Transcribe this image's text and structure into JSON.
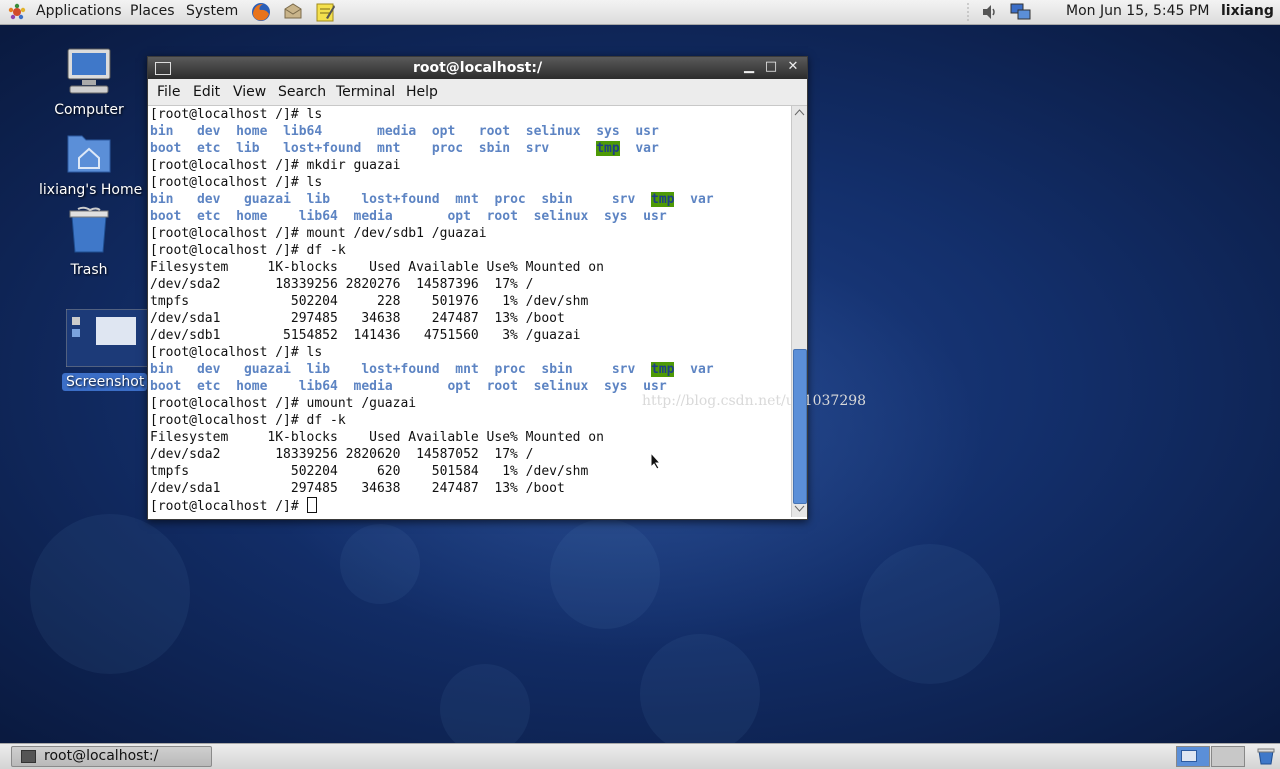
{
  "top_panel": {
    "menus": [
      "Applications",
      "Places",
      "System"
    ],
    "clock": "Mon Jun 15,  5:45 PM",
    "user": "lixiang"
  },
  "desktop": {
    "icons": [
      {
        "label": "Computer"
      },
      {
        "label": "lixiang's Home"
      },
      {
        "label": "Trash"
      },
      {
        "label": "Screenshot"
      }
    ]
  },
  "window": {
    "title": "root@localhost:/",
    "menu": [
      "File",
      "Edit",
      "View",
      "Search",
      "Terminal",
      "Help"
    ],
    "watermark": "http://blog.csdn.net/u01037298"
  },
  "terminal": {
    "lines": [
      {
        "t": "text",
        "v": "[root@localhost /]# ls"
      },
      {
        "t": "dirs",
        "v": [
          "bin   ",
          "dev  ",
          "home  ",
          "lib64       ",
          "media  ",
          "opt   ",
          "root  ",
          "selinux  ",
          "sys  ",
          "usr"
        ]
      },
      {
        "t": "dirs",
        "v": [
          "boot  ",
          "etc  ",
          "lib   ",
          "lost+found  ",
          "mnt    ",
          "proc  ",
          "sbin  ",
          "srv      ",
          "tmp  ",
          "var"
        ]
      },
      {
        "t": "text",
        "v": "[root@localhost /]# mkdir guazai"
      },
      {
        "t": "text",
        "v": "[root@localhost /]# ls"
      },
      {
        "t": "dirs",
        "v": [
          "bin   ",
          "dev   ",
          "guazai  ",
          "lib    ",
          "lost+found  ",
          "mnt  ",
          "proc  ",
          "sbin     ",
          "srv  ",
          "tmp  ",
          "var"
        ]
      },
      {
        "t": "dirs",
        "v": [
          "boot  ",
          "etc  ",
          "home    ",
          "lib64  ",
          "media       ",
          "opt  ",
          "root  ",
          "selinux  ",
          "sys  ",
          "usr"
        ]
      },
      {
        "t": "text",
        "v": "[root@localhost /]# mount /dev/sdb1 /guazai"
      },
      {
        "t": "text",
        "v": "[root@localhost /]# df -k"
      },
      {
        "t": "text",
        "v": "Filesystem     1K-blocks    Used Available Use% Mounted on"
      },
      {
        "t": "text",
        "v": "/dev/sda2       18339256 2820276  14587396  17% /"
      },
      {
        "t": "text",
        "v": "tmpfs             502204     228    501976   1% /dev/shm"
      },
      {
        "t": "text",
        "v": "/dev/sda1         297485   34638    247487  13% /boot"
      },
      {
        "t": "text",
        "v": "/dev/sdb1        5154852  141436   4751560   3% /guazai"
      },
      {
        "t": "text",
        "v": "[root@localhost /]# ls"
      },
      {
        "t": "dirs",
        "v": [
          "bin   ",
          "dev   ",
          "guazai  ",
          "lib    ",
          "lost+found  ",
          "mnt  ",
          "proc  ",
          "sbin     ",
          "srv  ",
          "tmp  ",
          "var"
        ]
      },
      {
        "t": "dirs",
        "v": [
          "boot  ",
          "etc  ",
          "home    ",
          "lib64  ",
          "media       ",
          "opt  ",
          "root  ",
          "selinux  ",
          "sys  ",
          "usr"
        ]
      },
      {
        "t": "text",
        "v": "[root@localhost /]# umount /guazai"
      },
      {
        "t": "text",
        "v": "[root@localhost /]# df -k"
      },
      {
        "t": "text",
        "v": "Filesystem     1K-blocks    Used Available Use% Mounted on"
      },
      {
        "t": "text",
        "v": "/dev/sda2       18339256 2820620  14587052  17% /"
      },
      {
        "t": "text",
        "v": "tmpfs             502204     620    501584   1% /dev/shm"
      },
      {
        "t": "text",
        "v": "/dev/sda1         297485   34638    247487  13% /boot"
      },
      {
        "t": "prompt",
        "v": "[root@localhost /]# "
      }
    ]
  },
  "taskbar": {
    "task_label": "root@localhost:/"
  },
  "colors": {
    "dir": "#5d84c3",
    "tmp_bg": "#4e9a06",
    "selection": "#3b6ec7"
  }
}
